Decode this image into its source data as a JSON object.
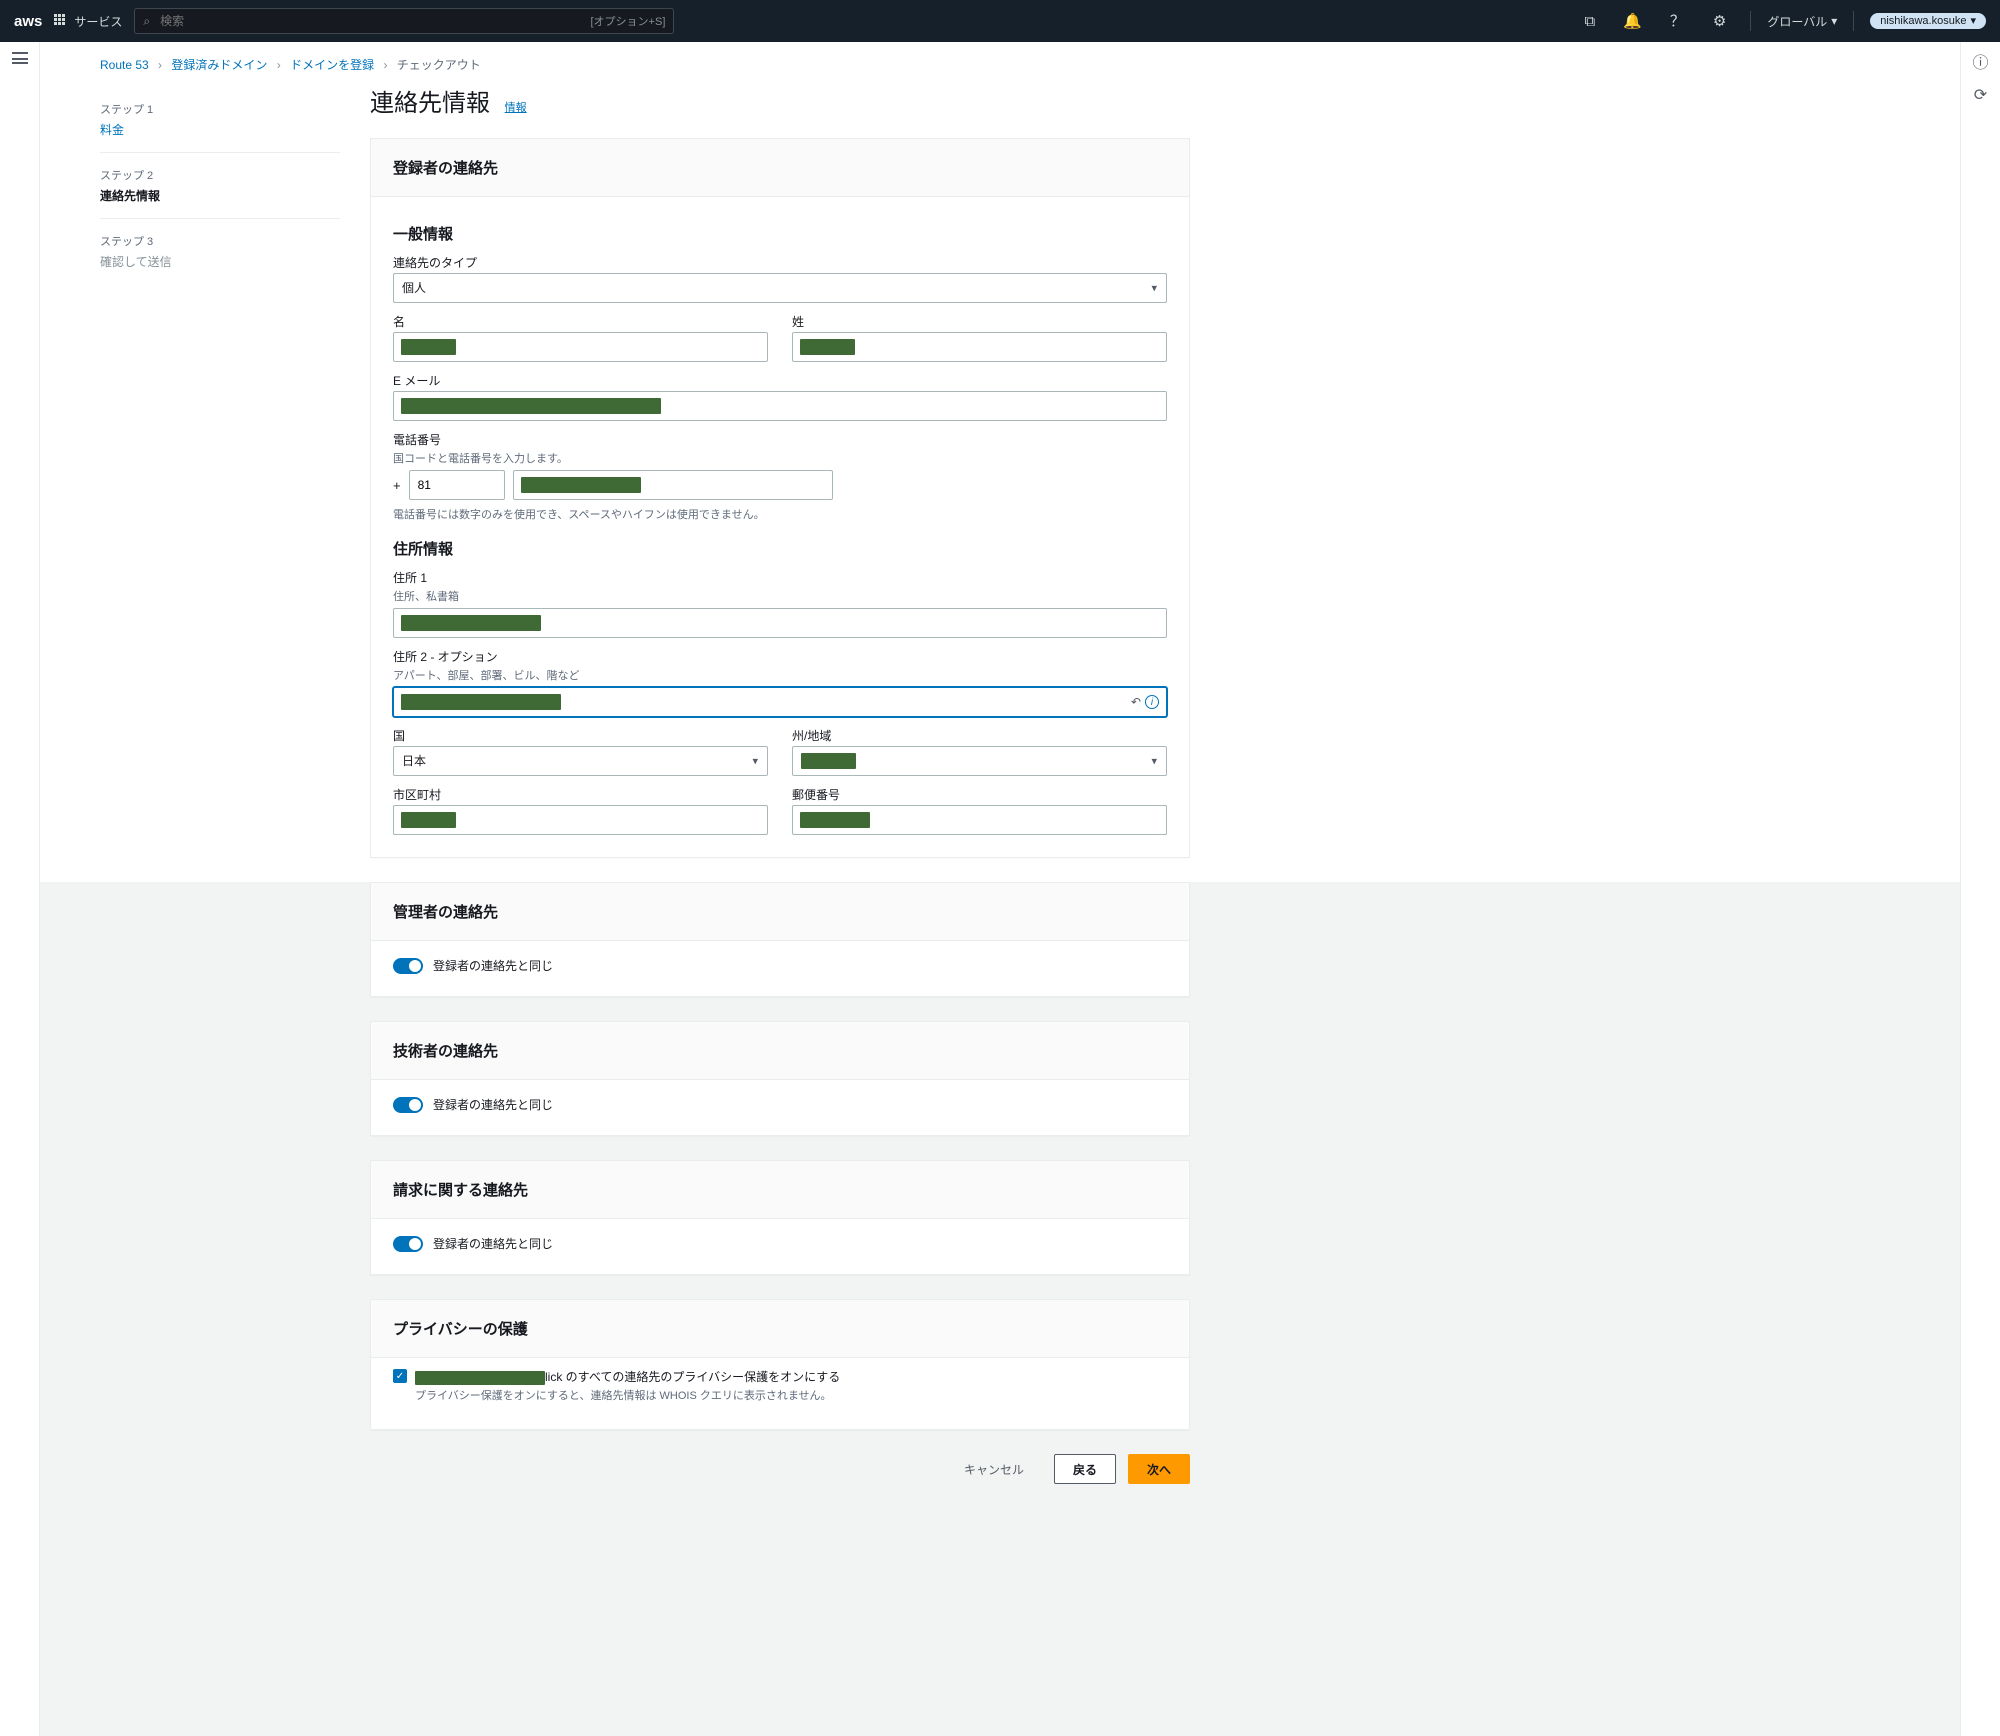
{
  "nav": {
    "services": "サービス",
    "search_placeholder": "検索",
    "search_kbd": "[オプション+S]",
    "region": "グローバル",
    "user": "nishikawa.kosuke"
  },
  "breadcrumbs": {
    "a": "Route 53",
    "b": "登録済みドメイン",
    "c": "ドメインを登録",
    "d": "チェックアウト"
  },
  "steps": {
    "s1_lbl": "ステップ 1",
    "s1_ttl": "料金",
    "s2_lbl": "ステップ 2",
    "s2_ttl": "連絡先情報",
    "s3_lbl": "ステップ 3",
    "s3_ttl": "確認して送信"
  },
  "page": {
    "title": "連絡先情報",
    "info": "情報"
  },
  "registrant": {
    "panel_title": "登録者の連絡先",
    "general": "一般情報",
    "contact_type": "連絡先のタイプ",
    "contact_type_value": "個人",
    "first_name": "名",
    "last_name": "姓",
    "email": "E メール",
    "phone": "電話番号",
    "phone_help": "国コードと電話番号を入力します。",
    "phone_plus": "+",
    "phone_cc": "81",
    "phone_rule": "電話番号には数字のみを使用でき、スペースやハイフンは使用できません。",
    "address": "住所情報",
    "addr1": "住所 1",
    "addr1_help": "住所、私書箱",
    "addr2": "住所 2 - オプション",
    "addr2_help": "アパート、部屋、部署、ビル、階など",
    "country": "国",
    "country_value": "日本",
    "state": "州/地域",
    "city": "市区町村",
    "zip": "郵便番号"
  },
  "admin": {
    "panel_title": "管理者の連絡先",
    "same": "登録者の連絡先と同じ"
  },
  "tech": {
    "panel_title": "技術者の連絡先",
    "same": "登録者の連絡先と同じ"
  },
  "billing": {
    "panel_title": "請求に関する連絡先",
    "same": "登録者の連絡先と同じ"
  },
  "privacy": {
    "panel_title": "プライバシーの保護",
    "chk_suffix": "lick のすべての連絡先のプライバシー保護をオンにする",
    "help": "プライバシー保護をオンにすると、連絡先情報は WHOIS クエリに表示されません。"
  },
  "footer": {
    "cancel": "キャンセル",
    "back": "戻る",
    "next": "次へ"
  }
}
